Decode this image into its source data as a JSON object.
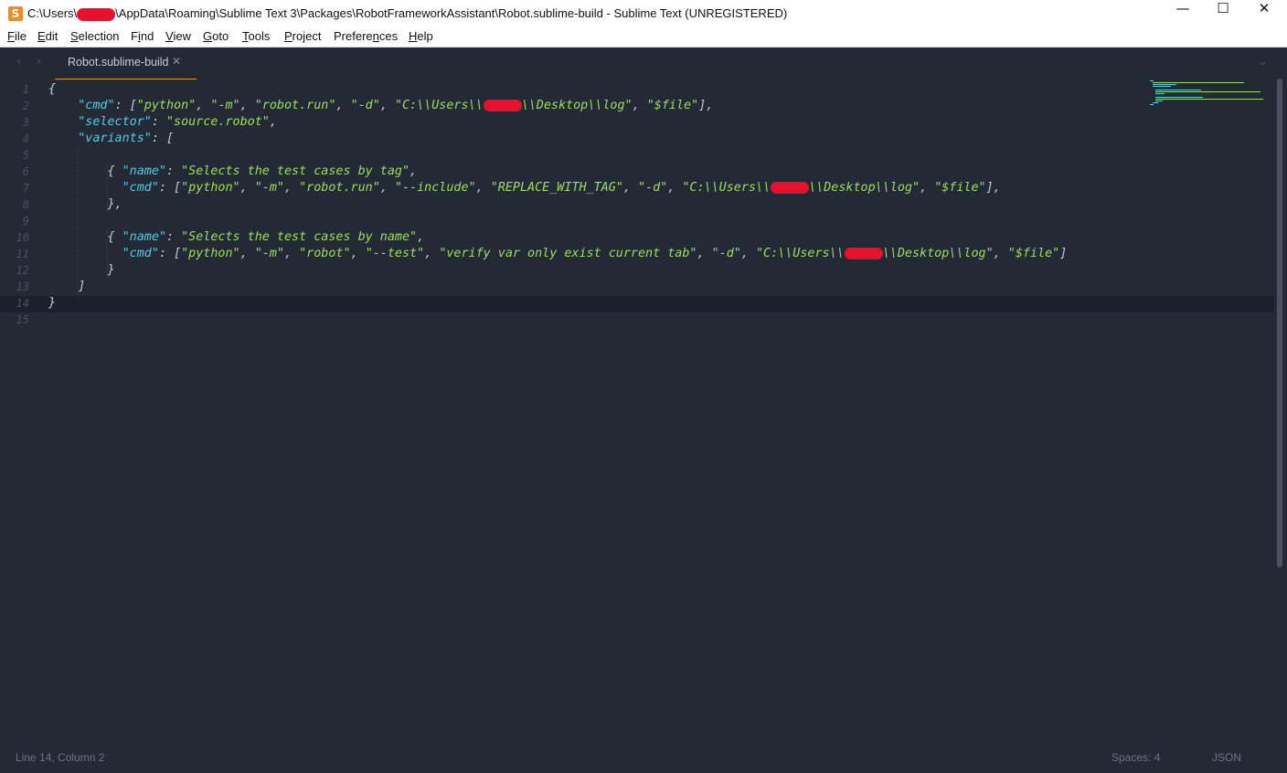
{
  "window": {
    "title_prefix": "C:\\Users\\",
    "title_suffix": "\\AppData\\Roaming\\Sublime Text 3\\Packages\\RobotFrameworkAssistant\\Robot.sublime-build - Sublime Text (UNREGISTERED)",
    "app_icon": "S",
    "controls": {
      "minimize": "—",
      "maximize": "☐",
      "close": "✕"
    }
  },
  "menu": [
    {
      "pre": "",
      "u": "F",
      "post": "ile"
    },
    {
      "pre": "",
      "u": "E",
      "post": "dit"
    },
    {
      "pre": "",
      "u": "S",
      "post": "election"
    },
    {
      "pre": "F",
      "u": "i",
      "post": "nd"
    },
    {
      "pre": "",
      "u": "V",
      "post": "iew"
    },
    {
      "pre": "",
      "u": "G",
      "post": "oto"
    },
    {
      "pre": "",
      "u": "T",
      "post": "ools"
    },
    {
      "pre": "",
      "u": "P",
      "post": "roject"
    },
    {
      "pre": "Prefere",
      "u": "n",
      "post": "ces"
    },
    {
      "pre": "",
      "u": "H",
      "post": "elp"
    }
  ],
  "tabs": {
    "nav_back": "‹",
    "nav_forward": "›",
    "active_label": "Robot.sublime-build",
    "close": "✕",
    "dropdown": "⌄"
  },
  "editor": {
    "line_numbers": [
      "1",
      "2",
      "3",
      "4",
      "5",
      "6",
      "7",
      "8",
      "9",
      "10",
      "11",
      "12",
      "13",
      "14",
      "15"
    ],
    "lines": [
      [
        [
          "p",
          "{"
        ]
      ],
      [
        [
          "k",
          "    \"cmd\""
        ],
        [
          "p",
          ": ["
        ],
        [
          "s",
          "\"python\""
        ],
        [
          "p",
          ", "
        ],
        [
          "s",
          "\"-m\""
        ],
        [
          "p",
          ", "
        ],
        [
          "s",
          "\"robot.run\""
        ],
        [
          "p",
          ", "
        ],
        [
          "s",
          "\"-d\""
        ],
        [
          "p",
          ", "
        ],
        [
          "s",
          "\"C:\\\\Users\\\\"
        ],
        [
          "r",
          ""
        ],
        [
          "s",
          "\\\\Desktop\\\\log\""
        ],
        [
          "p",
          ", "
        ],
        [
          "s",
          "\"$file\""
        ],
        [
          "p",
          "],"
        ]
      ],
      [
        [
          "k",
          "    \"selector\""
        ],
        [
          "p",
          ": "
        ],
        [
          "s",
          "\"source.robot\""
        ],
        [
          "p",
          ","
        ]
      ],
      [
        [
          "k",
          "    \"variants\""
        ],
        [
          "p",
          ": ["
        ]
      ],
      [
        [
          "p",
          ""
        ]
      ],
      [
        [
          "p",
          "        { "
        ],
        [
          "k",
          "\"name\""
        ],
        [
          "p",
          ": "
        ],
        [
          "s",
          "\"Selects the test cases by tag\""
        ],
        [
          "p",
          ","
        ]
      ],
      [
        [
          "k",
          "          \"cmd\""
        ],
        [
          "p",
          ": ["
        ],
        [
          "s",
          "\"python\""
        ],
        [
          "p",
          ", "
        ],
        [
          "s",
          "\"-m\""
        ],
        [
          "p",
          ", "
        ],
        [
          "s",
          "\"robot.run\""
        ],
        [
          "p",
          ", "
        ],
        [
          "s",
          "\"--include\""
        ],
        [
          "p",
          ", "
        ],
        [
          "s",
          "\"REPLACE_WITH_TAG\""
        ],
        [
          "p",
          ", "
        ],
        [
          "s",
          "\"-d\""
        ],
        [
          "p",
          ", "
        ],
        [
          "s",
          "\"C:\\\\Users\\\\"
        ],
        [
          "r",
          ""
        ],
        [
          "s",
          "\\\\Desktop\\\\log\""
        ],
        [
          "p",
          ", "
        ],
        [
          "s",
          "\"$file\""
        ],
        [
          "p",
          "],"
        ]
      ],
      [
        [
          "p",
          "        },"
        ]
      ],
      [
        [
          "p",
          ""
        ]
      ],
      [
        [
          "p",
          "        { "
        ],
        [
          "k",
          "\"name\""
        ],
        [
          "p",
          ": "
        ],
        [
          "s",
          "\"Selects the test cases by name\""
        ],
        [
          "p",
          ","
        ]
      ],
      [
        [
          "k",
          "          \"cmd\""
        ],
        [
          "p",
          ": ["
        ],
        [
          "s",
          "\"python\""
        ],
        [
          "p",
          ", "
        ],
        [
          "s",
          "\"-m\""
        ],
        [
          "p",
          ", "
        ],
        [
          "s",
          "\"robot\""
        ],
        [
          "p",
          ", "
        ],
        [
          "s",
          "\"--test\""
        ],
        [
          "p",
          ", "
        ],
        [
          "s",
          "\"verify var only exist current tab\""
        ],
        [
          "p",
          ", "
        ],
        [
          "s",
          "\"-d\""
        ],
        [
          "p",
          ", "
        ],
        [
          "s",
          "\"C:\\\\Users\\\\"
        ],
        [
          "r",
          ""
        ],
        [
          "s",
          "\\\\Desktop\\\\log\""
        ],
        [
          "p",
          ", "
        ],
        [
          "s",
          "\"$file\""
        ],
        [
          "p",
          "]"
        ]
      ],
      [
        [
          "p",
          "        }"
        ]
      ],
      [
        [
          "p",
          "    ]"
        ]
      ],
      [
        [
          "p",
          "}"
        ]
      ],
      [
        [
          "p",
          ""
        ]
      ]
    ]
  },
  "colors": {
    "background": "#232a36",
    "key": "#58c9e3",
    "string": "#9fdc60",
    "punctuation": "#c7ccd4",
    "tab_accent": "#d6a02c",
    "redaction": "#e8112d"
  },
  "status": {
    "position": "Line 14, Column 2",
    "indent": "Spaces: 4",
    "syntax": "JSON"
  }
}
